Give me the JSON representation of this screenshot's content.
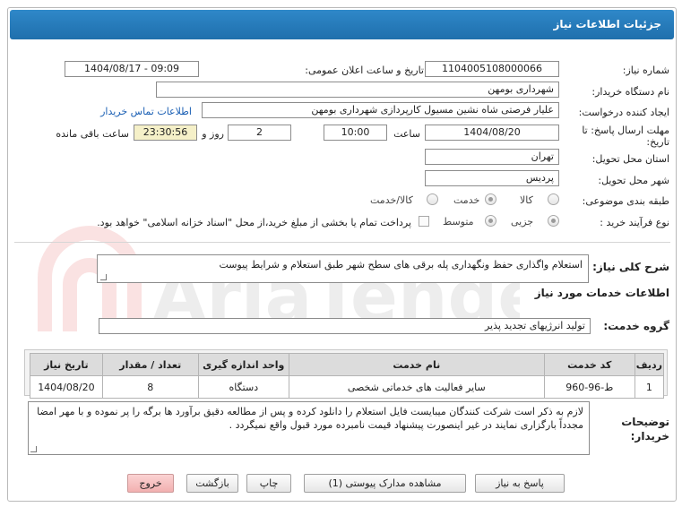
{
  "title": "جزئیات اطلاعات نیاز",
  "fields": {
    "need_number_label": "شماره نیاز:",
    "need_number": "1104005108000066",
    "announce_label": "تاریخ و ساعت اعلان عمومی:",
    "announce_value": "1404/08/17 - 09:09",
    "buyer_org_label": "نام دستگاه خریدار:",
    "buyer_org": "شهرداری بومهن",
    "creator_label": "ایجاد کننده درخواست:",
    "creator": "علیار فرصتی شاه نشین مسیول کارپردازی شهرداری بومهن",
    "contact_link": "اطلاعات تماس خریدار",
    "deadline_label_1": "مهلت ارسال پاسخ: تا",
    "deadline_label_2": "تاریخ:",
    "deadline_date": "1404/08/20",
    "time_label": "ساعت",
    "deadline_time": "10:00",
    "days_value": "2",
    "days_label": "روز و",
    "remaining_time": "23:30:56",
    "remaining_label": "ساعت باقی مانده",
    "province_label": "استان محل تحویل:",
    "province": "تهران",
    "city_label": "شهر محل تحویل:",
    "city": "پردیس",
    "category_label": "طبقه بندی موضوعی:",
    "category_options": [
      "کالا",
      "خدمت",
      "کالا/خدمت"
    ],
    "category_selected": "خدمت",
    "process_label": "نوع فرآیند خرید :",
    "process_options": [
      "جزیی",
      "متوسط"
    ],
    "process_selected": "جزیی",
    "payment_note": "پرداخت تمام یا بخشی از مبلغ خرید،از محل \"اسناد خزانه اسلامی\" خواهد بود."
  },
  "description": {
    "label": "شرح کلی نیاز:",
    "text": "استعلام واگذاری حفظ ونگهداری پله برقی های  سطح شهر  طبق استعلام و شرایط پیوست"
  },
  "services": {
    "section_title": "اطلاعات خدمات مورد نیاز",
    "group_label": "گروه خدمت:",
    "group_value": "تولید انرژیهای تجدید پذیر",
    "columns": [
      "ردیف",
      "کد خدمت",
      "نام خدمت",
      "واحد اندازه گیری",
      "تعداد / مقدار",
      "تاریخ نیاز"
    ],
    "rows": [
      [
        "1",
        "ط-96-960",
        "سایر فعالیت های خدماتی شخصی",
        "دستگاه",
        "8",
        "1404/08/20"
      ]
    ]
  },
  "buyer_notes": {
    "label_1": "توضیحات",
    "label_2": "خریدار:",
    "text": "لازم به ذکر است شرکت کنندگان میبایست فایل استعلام را دانلود کرده و پس از مطالعه دقیق برآورد ها برگه را پر نموده و با مهر امضا مجدداً بارگزاری نمایند در غیر اینصورت پیشنهاد قیمت نامبرده مورد قبول واقع نمیگردد ."
  },
  "buttons": {
    "reply": "پاسخ به نیاز",
    "attachments": "مشاهده مدارک پیوستی (1)",
    "print": "چاپ",
    "back": "بازگشت",
    "exit": "خروج"
  },
  "watermark": "AriaTender.neT",
  "colors": {
    "header": "#2f88c9",
    "link": "#1a5fb4",
    "time_bg": "#f5f0c8",
    "exit_bg": "#f2b0b0",
    "watermark": "#e04848"
  }
}
